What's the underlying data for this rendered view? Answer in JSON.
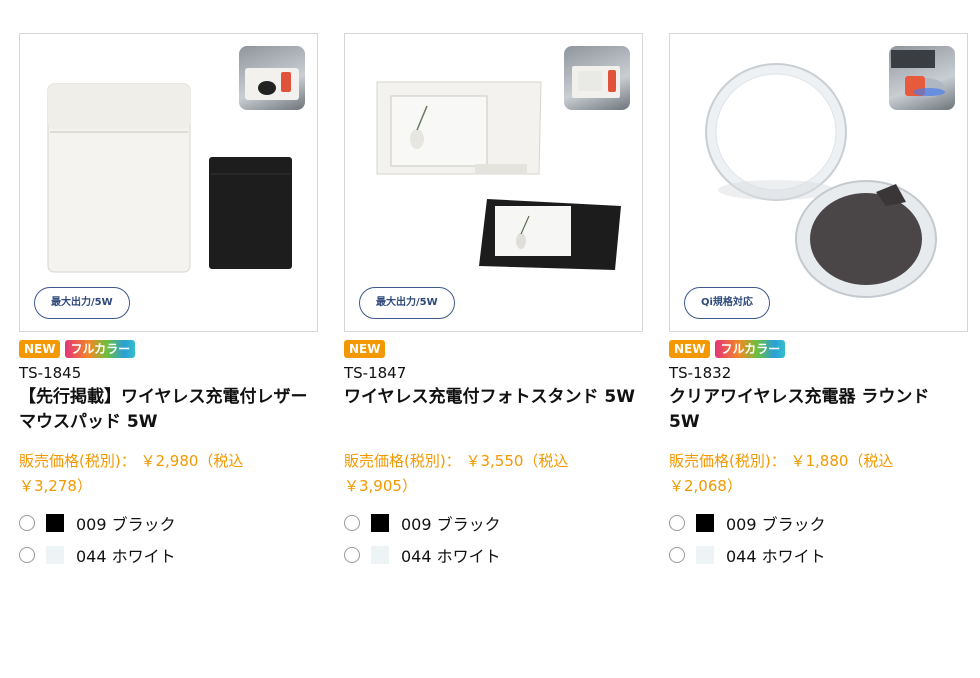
{
  "products": [
    {
      "code": "TS-1845",
      "name": "【先行掲載】ワイヤレス充電付レザーマウスパッド 5W",
      "price_line1": "販売価格(税別)： ￥2,980（税込",
      "price_line2": "￥3,278）",
      "spec": "最大出力/5W",
      "badges": [
        "NEW",
        "フルカラー"
      ],
      "colors": [
        {
          "label": "009 ブラック",
          "swatch": "#000000"
        },
        {
          "label": "044 ホワイト",
          "swatch": "#eef3f6"
        }
      ]
    },
    {
      "code": "TS-1847",
      "name": "ワイヤレス充電付フォトスタンド 5W",
      "price_line1": "販売価格(税別)： ￥3,550（税込",
      "price_line2": "￥3,905）",
      "spec": "最大出力/5W",
      "badges": [
        "NEW"
      ],
      "colors": [
        {
          "label": "009 ブラック",
          "swatch": "#000000"
        },
        {
          "label": "044 ホワイト",
          "swatch": "#eef3f6"
        }
      ]
    },
    {
      "code": "TS-1832",
      "name": "クリアワイヤレス充電器 ラウンド　5W",
      "price_line1": "販売価格(税別)： ￥1,880（税込",
      "price_line2": "￥2,068）",
      "spec": "Qi規格対応",
      "badges": [
        "NEW",
        "フルカラー"
      ],
      "colors": [
        {
          "label": "009 ブラック",
          "swatch": "#000000"
        },
        {
          "label": "044 ホワイト",
          "swatch": "#eef3f6"
        }
      ]
    }
  ],
  "theme": {
    "price_color": "#f39800",
    "new_badge_color": "#f39800",
    "spec_pill_color": "#3e5a8c"
  }
}
